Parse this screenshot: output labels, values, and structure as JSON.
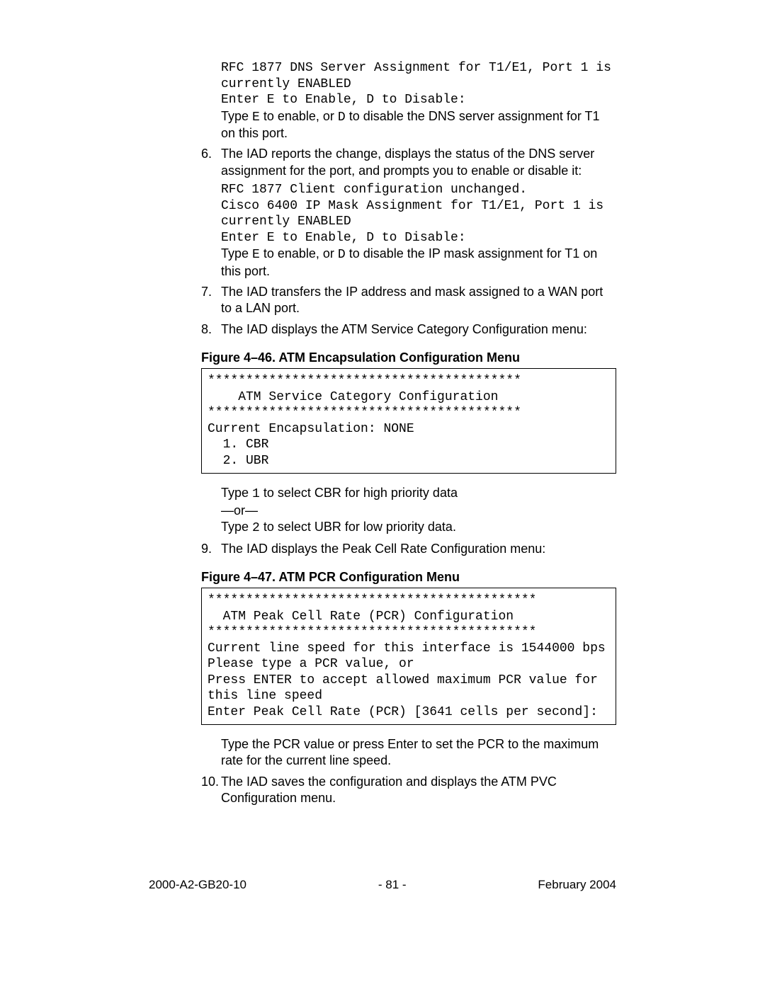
{
  "block1": {
    "mono_line1": "RFC 1877 DNS Server Assignment for T1/E1, Port 1 is",
    "mono_line2": "currently ENABLED",
    "mono_line3": "Enter E to Enable, D to Disable:",
    "text_line1a": "Type ",
    "text_line1b": "E",
    "text_line1c": " to enable, or ",
    "text_line1d": "D",
    "text_line1e": " to disable the DNS server assignment for T1 on this port."
  },
  "item6": {
    "num": "6.",
    "text": "The IAD reports the change, displays the status of the DNS server assignment for the port, and prompts you to enable or disable it:",
    "mono1": "RFC 1877 Client configuration unchanged.",
    "mono2": "Cisco 6400 IP Mask Assignment for T1/E1, Port 1 is",
    "mono3": "currently ENABLED",
    "mono4": "Enter E to Enable, D to Disable:",
    "tail_a": "Type ",
    "tail_b": "E",
    "tail_c": " to enable, or ",
    "tail_d": "D",
    "tail_e": " to disable the IP mask assignment for T1 on this port."
  },
  "item7": {
    "num": "7.",
    "text": "The IAD transfers the IP address and mask assigned to a WAN port to a LAN port."
  },
  "item8": {
    "num": "8.",
    "text": "The IAD displays the ATM Service Category Configuration menu:"
  },
  "fig46": {
    "caption": "Figure 4–46.  ATM Encapsulation Configuration Menu",
    "box": "*****************************************\n    ATM Service Category Configuration\n*****************************************\nCurrent Encapsulation: NONE\n  1. CBR\n  2. UBR"
  },
  "after46": {
    "line1a": "Type ",
    "line1b": "1",
    "line1c": " to select CBR for high priority data",
    "or": "—or—",
    "line2a": "Type ",
    "line2b": "2",
    "line2c": " to select UBR for low priority data."
  },
  "item9": {
    "num": "9.",
    "text": "The IAD displays the Peak Cell Rate Configuration menu:"
  },
  "fig47": {
    "caption": "Figure 4–47.  ATM PCR Configuration Menu",
    "box": "*******************************************\n  ATM Peak Cell Rate (PCR) Configuration\n*******************************************\nCurrent line speed for this interface is 1544000 bps\nPlease type a PCR value, or\nPress ENTER to accept allowed maximum PCR value for\nthis line speed\nEnter Peak Cell Rate (PCR) [3641 cells per second]:"
  },
  "after47": {
    "text": "Type the PCR value or press Enter to set the PCR to the maximum rate for the current line speed."
  },
  "item10": {
    "num": "10.",
    "text": "The IAD saves the configuration and displays the ATM PVC Configuration menu."
  },
  "footer": {
    "left": "2000-A2-GB20-10",
    "center": "- 81 -",
    "right": "February 2004"
  },
  "chart_data": {
    "type": "table",
    "title": "ATM PCR Configuration values on page",
    "values": {
      "current_line_speed_bps": 1544000,
      "default_pcr_cells_per_second": 3641
    }
  }
}
